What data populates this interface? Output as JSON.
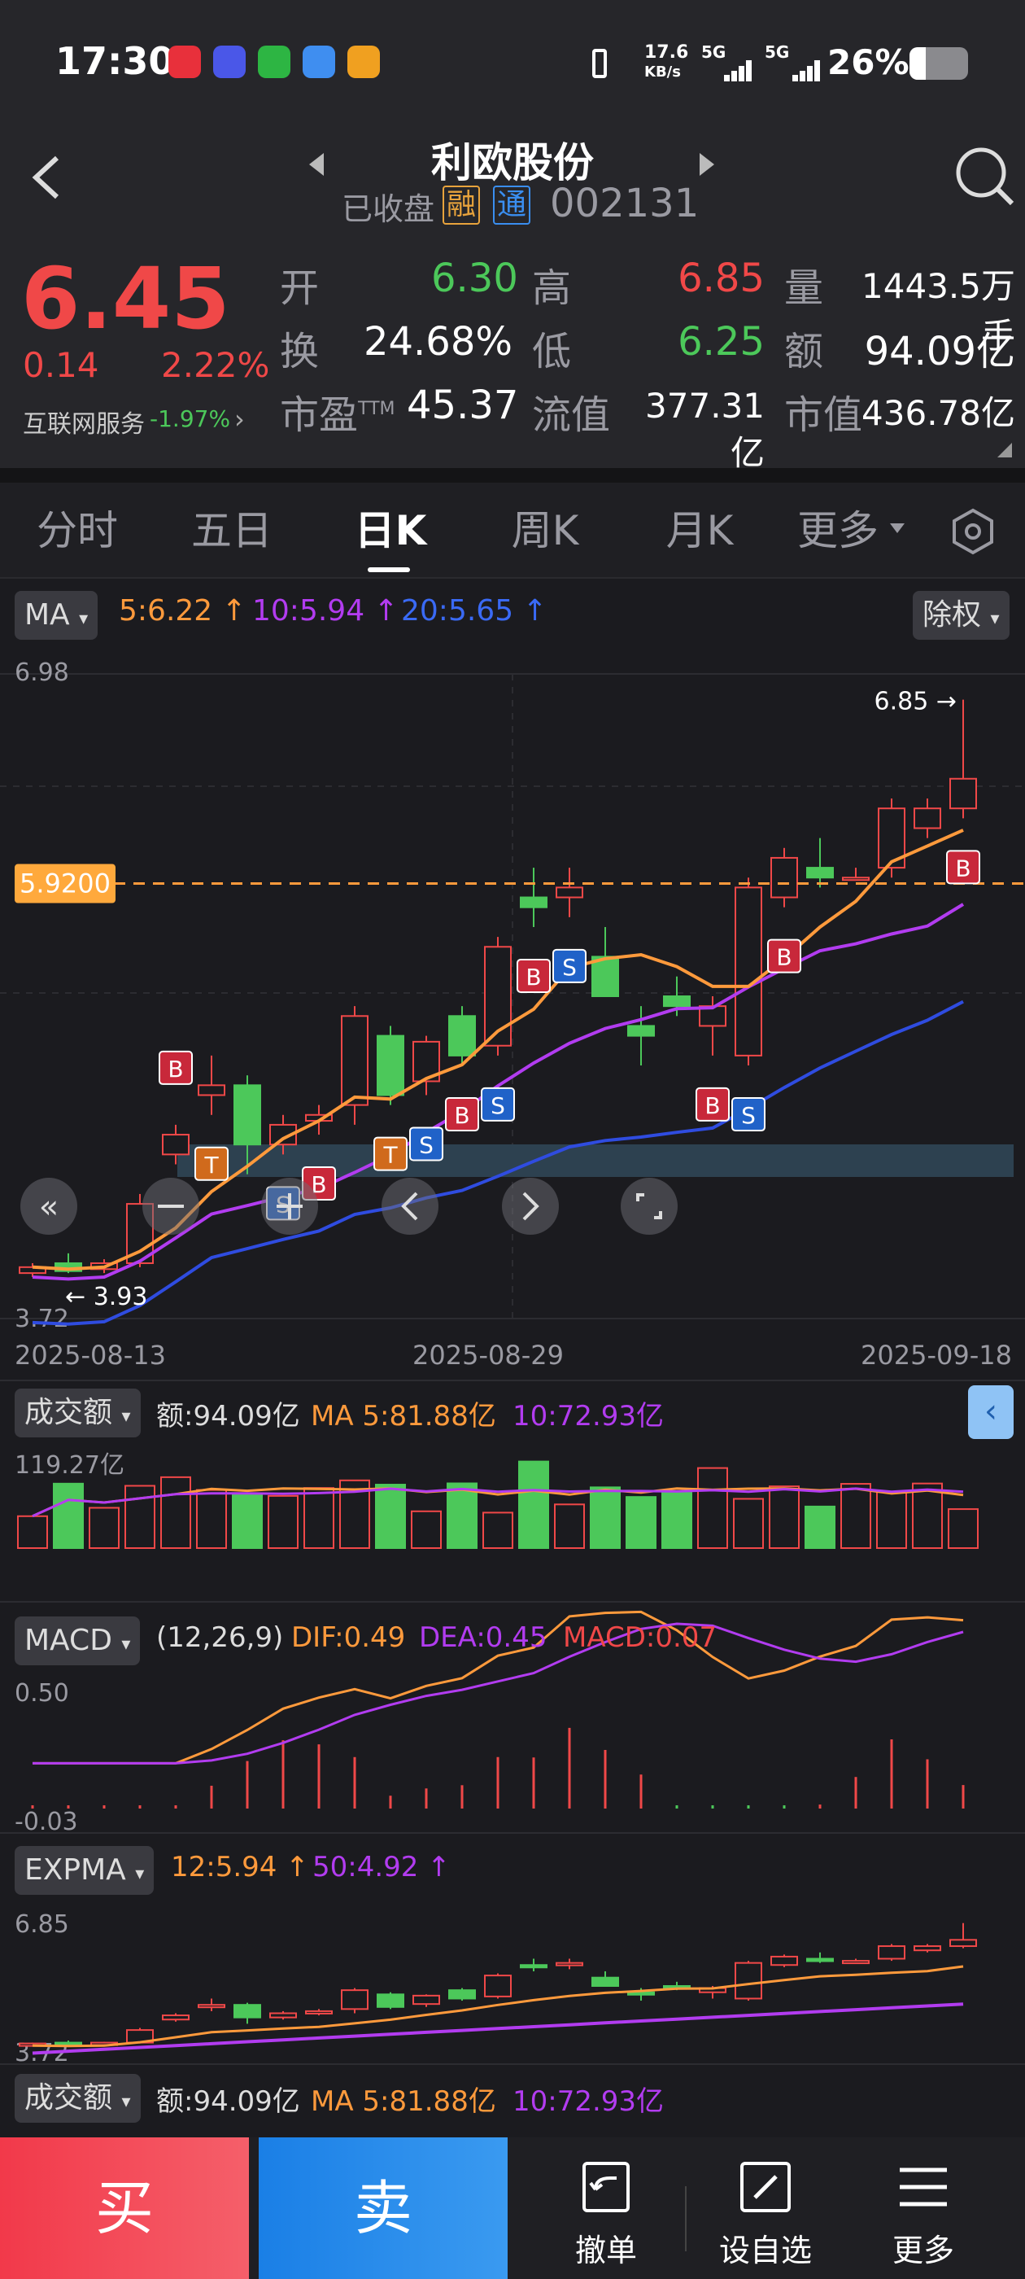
{
  "status": {
    "time": "17:30",
    "net_speed": "17.6",
    "net_unit": "KB/s",
    "sim1": "5G",
    "sim2": "5G",
    "battery": "26%"
  },
  "header": {
    "title": "利欧股份",
    "state": "已收盘",
    "badge1": "融",
    "badge2": "通",
    "code": "002131"
  },
  "quote": {
    "price": "6.45",
    "change": "0.14",
    "change_pct": "2.22%",
    "sector": "互联网服务",
    "sector_pct": "-1.97%",
    "labels": {
      "open": "开",
      "high": "高",
      "vol": "量",
      "turnover": "换",
      "low": "低",
      "amount": "额",
      "pe": "市盈",
      "pe_sup": "TTM",
      "float": "流值",
      "mktcap": "市值"
    },
    "values": {
      "open": "6.30",
      "high": "6.85",
      "vol": "1443.5万手",
      "turnover": "24.68%",
      "low": "6.25",
      "amount": "94.09亿",
      "pe": "45.37",
      "float": "377.31亿",
      "mktcap": "436.78亿"
    }
  },
  "tabs": [
    "分时",
    "五日",
    "日K",
    "周K",
    "月K",
    "更多"
  ],
  "active_tab": "日K",
  "ma_bar": {
    "selector": "MA",
    "ma5": "5:6.22",
    "ma10": "10:5.94",
    "ma20": "20:5.65",
    "right_button": "除权"
  },
  "main_chart": {
    "ymax_label": "6.98",
    "ymin_label": "3.72",
    "high_marker": "6.85",
    "low_marker": "3.93",
    "price_line_label": "5.9200",
    "dates": [
      "2025-08-13",
      "2025-08-29",
      "2025-09-18"
    ]
  },
  "volume_panel": {
    "selector": "成交额",
    "amount": "额:94.09亿",
    "ma5": "MA 5:81.88亿",
    "ma10": "10:72.93亿",
    "ymax": "119.27亿"
  },
  "macd_panel": {
    "selector": "MACD",
    "params": "(12,26,9)",
    "dif": "DIF:0.49",
    "dea": "DEA:0.45",
    "macd": "MACD:0.07",
    "ymax": "0.50",
    "ymin": "-0.03"
  },
  "expma_panel": {
    "selector": "EXPMA",
    "e12": "12:5.94",
    "e50": "50:4.92",
    "ymax": "6.85",
    "ymin": "3.72"
  },
  "volume_panel2": {
    "selector": "成交额",
    "amount": "额:94.09亿",
    "ma5": "MA 5:81.88亿",
    "ma10": "10:72.93亿"
  },
  "bottom": {
    "buy": "买",
    "sell": "卖",
    "cancel": "撤单",
    "watch": "设自选",
    "more": "更多"
  },
  "colors": {
    "up": "#f04848",
    "down": "#4cc85a",
    "ma5": "#ff9a3c",
    "ma10": "#b23cf0",
    "ma20": "#2f4ce0",
    "buy": "#f5424f",
    "sell": "#1f86e8"
  },
  "chart_data": {
    "type": "candlestick",
    "title": "",
    "x": [
      "2025-08-13",
      "",
      "",
      "",
      "",
      "",
      "",
      "",
      "",
      "",
      "",
      "2025-08-29",
      "",
      "",
      "",
      "",
      "",
      "",
      "",
      "",
      "",
      "",
      "",
      "",
      "",
      "",
      "2025-09-18"
    ],
    "ohlc": [
      [
        3.95,
        4.0,
        3.93,
        3.98
      ],
      [
        4.0,
        4.05,
        3.95,
        3.96
      ],
      [
        3.97,
        4.02,
        3.95,
        4.0
      ],
      [
        4.0,
        4.35,
        3.98,
        4.3
      ],
      [
        4.55,
        4.7,
        4.5,
        4.65
      ],
      [
        4.85,
        5.05,
        4.75,
        4.9
      ],
      [
        4.9,
        4.95,
        4.45,
        4.6
      ],
      [
        4.6,
        4.75,
        4.55,
        4.7
      ],
      [
        4.72,
        4.8,
        4.65,
        4.75
      ],
      [
        4.8,
        5.3,
        4.7,
        5.25
      ],
      [
        5.15,
        5.2,
        4.8,
        4.85
      ],
      [
        4.92,
        5.15,
        4.85,
        5.12
      ],
      [
        5.25,
        5.3,
        5.0,
        5.05
      ],
      [
        5.1,
        5.65,
        5.05,
        5.6
      ],
      [
        5.85,
        6.0,
        5.7,
        5.8
      ],
      [
        5.85,
        6.0,
        5.75,
        5.9
      ],
      [
        5.55,
        5.7,
        5.4,
        5.35
      ],
      [
        5.2,
        5.3,
        5.0,
        5.15
      ],
      [
        5.35,
        5.45,
        5.25,
        5.3
      ],
      [
        5.2,
        5.35,
        5.05,
        5.3
      ],
      [
        5.05,
        5.95,
        5.0,
        5.9
      ],
      [
        5.85,
        6.1,
        5.8,
        6.05
      ],
      [
        6.0,
        6.15,
        5.9,
        5.95
      ],
      [
        5.95,
        6.0,
        5.95,
        5.95
      ],
      [
        6.0,
        6.35,
        5.95,
        6.3
      ],
      [
        6.2,
        6.35,
        6.15,
        6.3
      ],
      [
        6.3,
        6.85,
        6.25,
        6.45
      ]
    ],
    "ylim": [
      3.72,
      6.98
    ]
  }
}
